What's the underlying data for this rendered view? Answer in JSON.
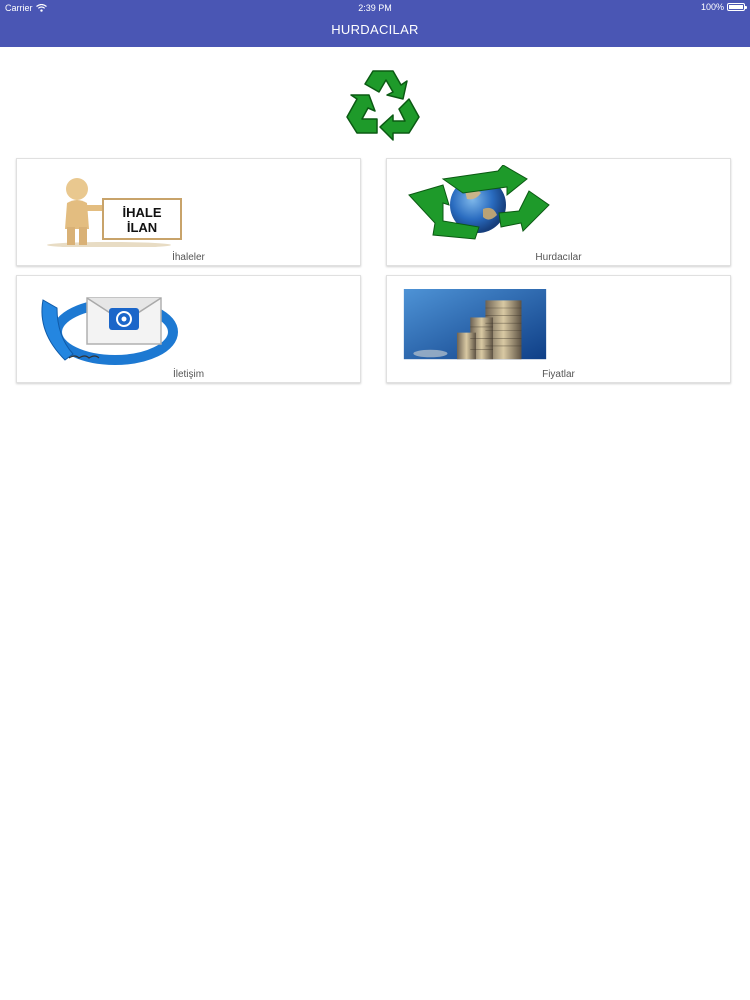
{
  "status_bar": {
    "carrier": "Carrier",
    "time": "2:39 PM",
    "battery": "100%",
    "battery_level": 1.0
  },
  "nav": {
    "title": "HURDACILAR"
  },
  "logo": {
    "icon": "recycle-icon",
    "color": "#1e9a2a"
  },
  "accent_color": "#4a56b4",
  "tiles": [
    {
      "label": "İhaleler",
      "icon": "tender-announcement-icon",
      "sign_lines": [
        "İHALE",
        "İLAN"
      ]
    },
    {
      "label": "Hurdacılar",
      "icon": "recycling-globe-icon"
    },
    {
      "label": "İletişim",
      "icon": "phone-mail-icon"
    },
    {
      "label": "Fiyatlar",
      "icon": "coins-icon"
    }
  ]
}
